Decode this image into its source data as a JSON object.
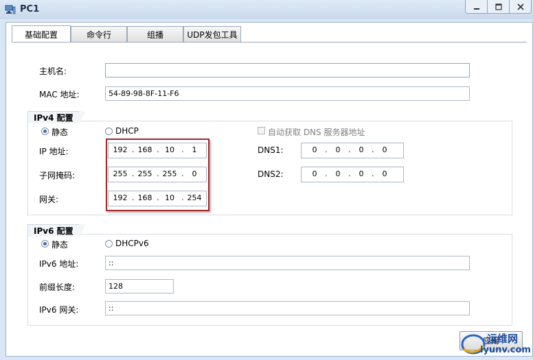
{
  "window": {
    "title": "PC1"
  },
  "tabs": [
    {
      "label": "基础配置"
    },
    {
      "label": "命令行"
    },
    {
      "label": "组播"
    },
    {
      "label": "UDP发包工具"
    }
  ],
  "basic": {
    "hostname_label": "主机名:",
    "hostname_value": "",
    "mac_label": "MAC 地址:",
    "mac_value": "54-89-98-8F-11-F6"
  },
  "ipv4": {
    "group_title": "IPv4 配置",
    "static_label": "静态",
    "dhcp_label": "DHCP",
    "auto_dns_label": "自动获取 DNS 服务器地址",
    "ip_label": "IP 地址:",
    "mask_label": "子网掩码:",
    "gateway_label": "网关:",
    "dns1_label": "DNS1:",
    "dns2_label": "DNS2:",
    "ip": [
      "192",
      "168",
      "10",
      "1"
    ],
    "mask": [
      "255",
      "255",
      "255",
      "0"
    ],
    "gateway": [
      "192",
      "168",
      "10",
      "254"
    ],
    "dns1": [
      "0",
      "0",
      "0",
      "0"
    ],
    "dns2": [
      "0",
      "0",
      "0",
      "0"
    ]
  },
  "ipv6": {
    "group_title": "IPv6 配置",
    "static_label": "静态",
    "dhcp_label": "DHCPv6",
    "address_label": "IPv6 地址:",
    "address_value": "::",
    "prefix_label": "前缀长度:",
    "prefix_value": "128",
    "gateway_label": "IPv6 网关:",
    "gateway_value": "::"
  },
  "footer": {
    "apply_label": "应用"
  },
  "watermark": {
    "line1": "运维网",
    "line2": "iyunv.com"
  }
}
